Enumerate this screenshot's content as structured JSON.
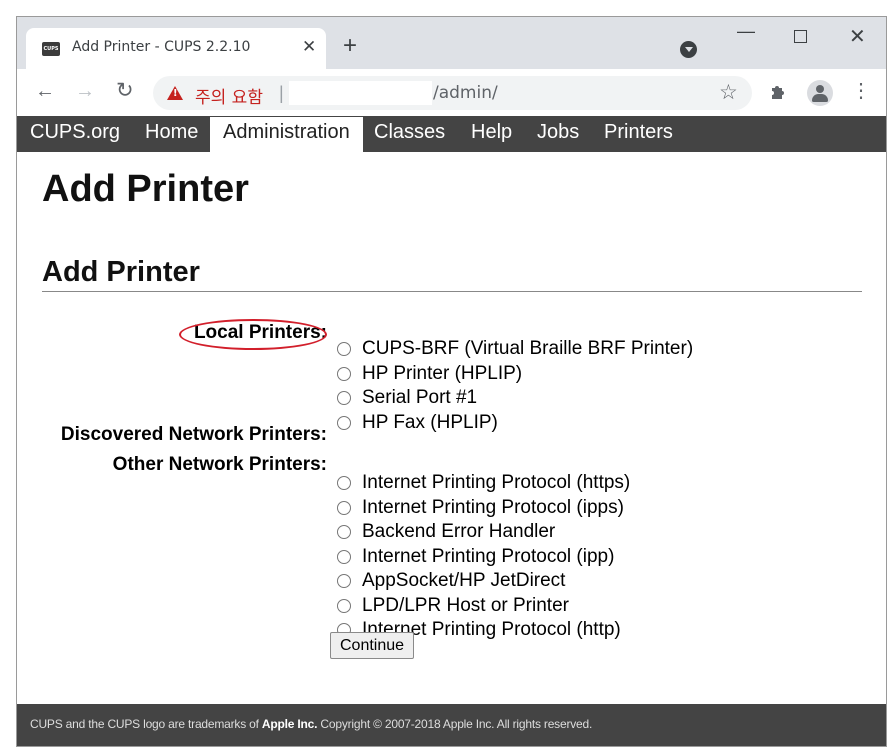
{
  "browser": {
    "tab": {
      "favicon_text": "CUPS",
      "title": "Add Printer - CUPS 2.2.10",
      "close_glyph": "✕"
    },
    "newtab_glyph": "+",
    "window_controls": {
      "minimize": "—",
      "close": "✕"
    },
    "toolbar": {
      "back_glyph": "←",
      "forward_glyph": "→",
      "reload_glyph": "↻",
      "warning_text": "주의 요함",
      "separator": "|",
      "url_path": "/admin/",
      "star_glyph": "☆",
      "menu_glyph": "⋮"
    }
  },
  "nav": {
    "items": [
      {
        "label": "CUPS.org",
        "active": false
      },
      {
        "label": "Home",
        "active": false
      },
      {
        "label": "Administration",
        "active": true
      },
      {
        "label": "Classes",
        "active": false
      },
      {
        "label": "Help",
        "active": false
      },
      {
        "label": "Jobs",
        "active": false
      },
      {
        "label": "Printers",
        "active": false
      }
    ]
  },
  "page": {
    "heading1": "Add Printer",
    "heading2": "Add Printer",
    "groups": {
      "local": {
        "label": "Local Printers:",
        "options": [
          "CUPS-BRF (Virtual Braille BRF Printer)",
          "HP Printer (HPLIP)",
          "Serial Port #1",
          "HP Fax (HPLIP)"
        ]
      },
      "discovered": {
        "label": "Discovered Network Printers:"
      },
      "other": {
        "label": "Other Network Printers:",
        "options": [
          "Internet Printing Protocol (https)",
          "Internet Printing Protocol (ipps)",
          "Backend Error Handler",
          "Internet Printing Protocol (ipp)",
          "AppSocket/HP JetDirect",
          "LPD/LPR Host or Printer",
          "Internet Printing Protocol (http)"
        ]
      }
    },
    "continue_label": "Continue"
  },
  "footer": {
    "prefix": "CUPS and the CUPS logo are trademarks of ",
    "brand": "Apple Inc.",
    "suffix": " Copyright © 2007-2018 Apple Inc. All rights reserved."
  },
  "colors": {
    "nav_bg": "#444444",
    "warning_red": "#c5221f",
    "annotation_red": "#d21f2b"
  }
}
